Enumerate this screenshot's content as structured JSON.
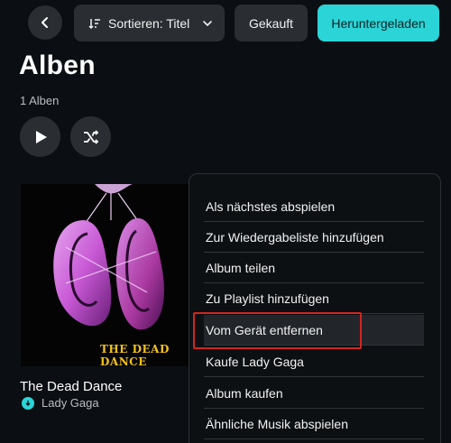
{
  "toolbar": {
    "back_icon": "chevron-left-icon",
    "sort_icon": "sort-icon",
    "sort_label": "Sortieren: Titel",
    "sort_chevron_icon": "chevron-down-icon",
    "purchased_label": "Gekauft",
    "downloaded_label": "Heruntergeladen"
  },
  "header": {
    "title": "Alben",
    "count": "1 Alben"
  },
  "controls": {
    "play_icon": "play-icon",
    "shuffle_icon": "shuffle-icon"
  },
  "album": {
    "title": "The Dead Dance",
    "artist": "Lady Gaga",
    "art_text": "THE DEAD DANCE",
    "downloaded_icon": "download-badge-icon"
  },
  "menu": {
    "items": [
      "Als nächstes abspielen",
      "Zur Wiedergabeliste hinzufügen",
      "Album teilen",
      "Zu Playlist hinzufügen",
      "Vom Gerät entfernen",
      "Kaufe Lady Gaga",
      "Album kaufen",
      "Ähnliche Musik abspielen"
    ],
    "highlighted_index": 4
  },
  "colors": {
    "accent": "#2bd4d6",
    "highlight_border": "#d0261f",
    "background": "#0b0f13"
  }
}
